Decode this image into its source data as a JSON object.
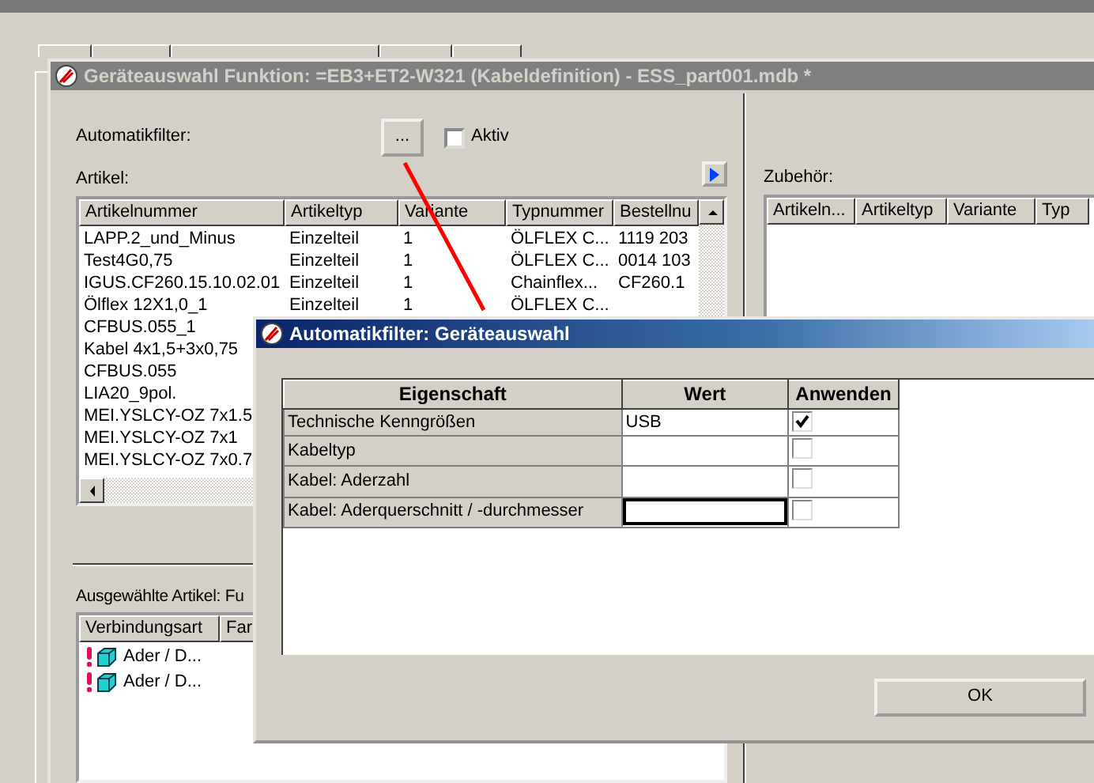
{
  "main_window": {
    "title": "Geräteauswahl Funktion: =EB3+ET2-W321 (Kabeldefinition) - ESS_part001.mdb *",
    "active": false,
    "filter": {
      "label": "Automatikfilter:",
      "button": "...",
      "checkbox": {
        "label": "Aktiv",
        "checked": false
      }
    },
    "articles": {
      "label": "Artikel:",
      "columns": [
        "Artikelnummer",
        "Artikeltyp",
        "Variante",
        "Typnummer",
        "Bestellnu"
      ],
      "rows": [
        [
          "LAPP.2_und_Minus",
          "Einzelteil",
          "1",
          "ÖLFLEX C...",
          "1119 203"
        ],
        [
          "Test4G0,75",
          "Einzelteil",
          "1",
          "ÖLFLEX C...",
          "0014 103"
        ],
        [
          "IGUS.CF260.15.10.02.01",
          "Einzelteil",
          "1",
          "Chainflex...",
          "CF260.1"
        ],
        [
          "Ölflex 12X1,0_1",
          "Einzelteil",
          "1",
          "ÖLFLEX C..."
        ],
        [
          "CFBUS.055_1"
        ],
        [
          "Kabel 4x1,5+3x0,75"
        ],
        [
          "CFBUS.055"
        ],
        [
          "LIA20_9pol."
        ],
        [
          "MEI.YSLCY-OZ 7x1.5"
        ],
        [
          "MEI.YSLCY-OZ 7x1"
        ],
        [
          "MEI.YSLCY-OZ 7x0.7"
        ]
      ]
    },
    "accessories": {
      "label": "Zubehör:",
      "columns": [
        "Artikeln...",
        "Artikeltyp",
        "Variante",
        "Typ"
      ]
    },
    "selected_articles": {
      "label": "Ausgewählte Artikel: Fu",
      "columns": [
        "Verbindungsart",
        "Far"
      ],
      "rows": [
        {
          "text": "Ader / D...",
          "warning": true
        },
        {
          "text": "Ader / D...",
          "warning": true
        }
      ]
    }
  },
  "dialog": {
    "title": "Automatikfilter: Geräteauswahl",
    "active": true,
    "columns": [
      "Eigenschaft",
      "Wert",
      "Anwenden"
    ],
    "rows": [
      {
        "property": "Technische Kenngrößen",
        "value": "USB",
        "apply": true,
        "focused": false
      },
      {
        "property": "Kabeltyp",
        "apply": false,
        "focused": false
      },
      {
        "property": "Kabel: Aderzahl",
        "apply": false,
        "focused": false
      },
      {
        "property": "Kabel: Aderquerschnitt / -durchmesser",
        "apply": false,
        "focused": true
      }
    ],
    "ok_button": "OK"
  }
}
